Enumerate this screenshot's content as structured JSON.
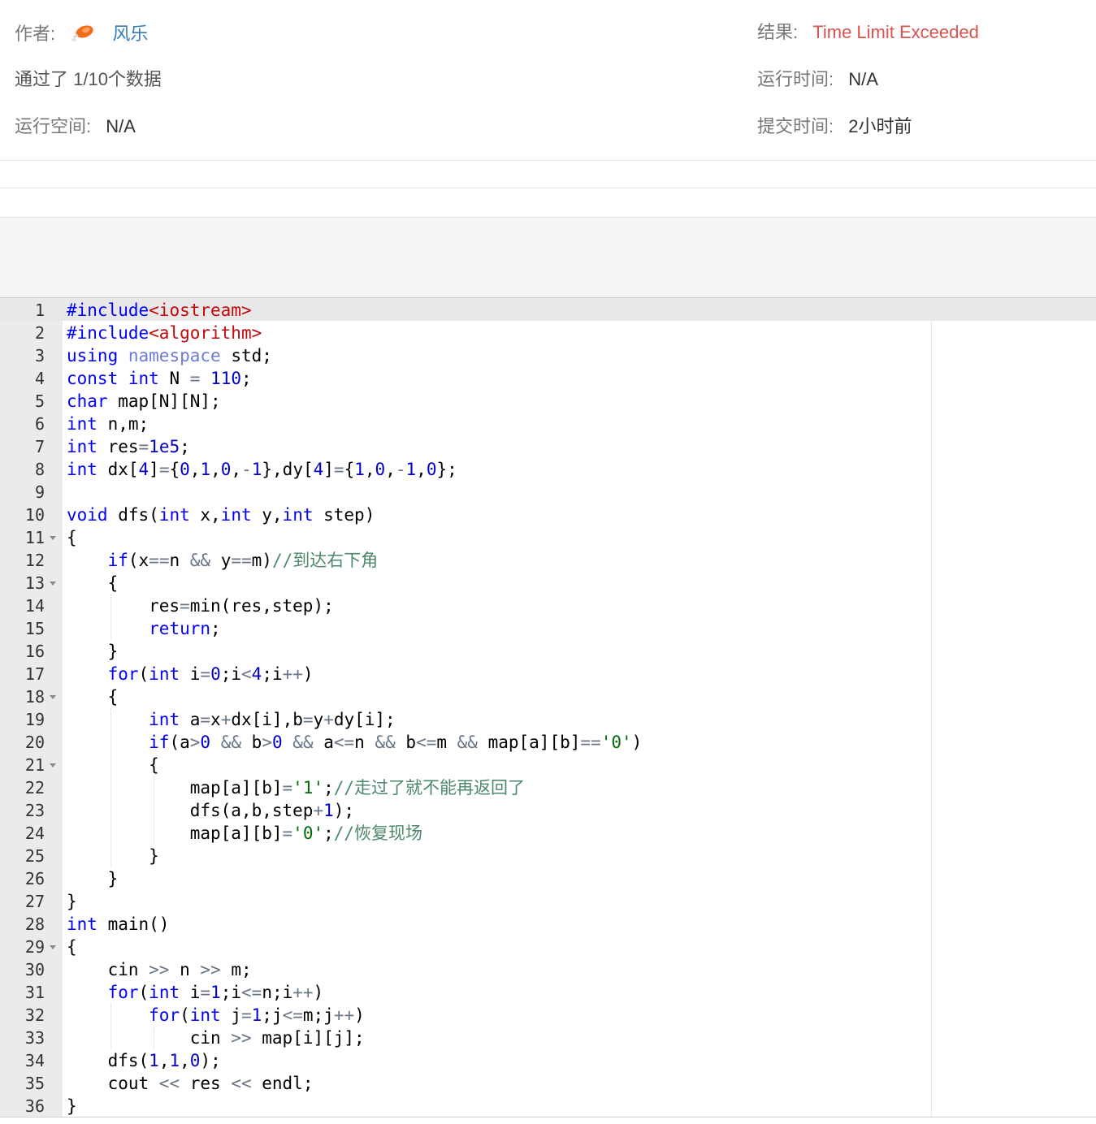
{
  "submission": {
    "author_label": "作者:",
    "author_name": "风乐",
    "result_label": "结果:",
    "result_value": "Time Limit Exceeded",
    "passed_text": "通过了 1/10个数据",
    "run_time_label": "运行时间:",
    "run_time_value": "N/A",
    "memory_label": "运行空间:",
    "memory_value": "N/A",
    "submit_time_label": "提交时间:",
    "submit_time_value": "2小时前"
  },
  "colors": {
    "result_red": "#d9534f",
    "author_link": "#337ab7",
    "keyword": "#0000ff",
    "string": "#c5060b",
    "number": "#0000cd",
    "comment": "#4c886b",
    "operator": "#687687",
    "char_literal": "#036a07"
  },
  "editor": {
    "active_line": 1,
    "fold_lines": [
      11,
      13,
      18,
      21,
      29
    ],
    "lines": [
      [
        [
          "kw",
          "#include"
        ],
        [
          "str",
          "<iostream>"
        ]
      ],
      [
        [
          "kw",
          "#include"
        ],
        [
          "str",
          "<algorithm>"
        ]
      ],
      [
        [
          "kw",
          "using"
        ],
        [
          "pl",
          " "
        ],
        [
          "ns",
          "namespace"
        ],
        [
          "pl",
          " std;"
        ]
      ],
      [
        [
          "kw",
          "const"
        ],
        [
          "pl",
          " "
        ],
        [
          "kw",
          "int"
        ],
        [
          "pl",
          " N "
        ],
        [
          "op",
          "="
        ],
        [
          "pl",
          " "
        ],
        [
          "num",
          "110"
        ],
        [
          "pl",
          ";"
        ]
      ],
      [
        [
          "kw",
          "char"
        ],
        [
          "pl",
          " map[N][N];"
        ]
      ],
      [
        [
          "kw",
          "int"
        ],
        [
          "pl",
          " n,m;"
        ]
      ],
      [
        [
          "kw",
          "int"
        ],
        [
          "pl",
          " res"
        ],
        [
          "op",
          "="
        ],
        [
          "num",
          "1e5"
        ],
        [
          "pl",
          ";"
        ]
      ],
      [
        [
          "kw",
          "int"
        ],
        [
          "pl",
          " dx["
        ],
        [
          "num",
          "4"
        ],
        [
          "pl",
          "]"
        ],
        [
          "op",
          "="
        ],
        [
          "pl",
          "{"
        ],
        [
          "num",
          "0"
        ],
        [
          "pl",
          ","
        ],
        [
          "num",
          "1"
        ],
        [
          "pl",
          ","
        ],
        [
          "num",
          "0"
        ],
        [
          "pl",
          ","
        ],
        [
          "op",
          "-"
        ],
        [
          "num",
          "1"
        ],
        [
          "pl",
          "},dy["
        ],
        [
          "num",
          "4"
        ],
        [
          "pl",
          "]"
        ],
        [
          "op",
          "="
        ],
        [
          "pl",
          "{"
        ],
        [
          "num",
          "1"
        ],
        [
          "pl",
          ","
        ],
        [
          "num",
          "0"
        ],
        [
          "pl",
          ","
        ],
        [
          "op",
          "-"
        ],
        [
          "num",
          "1"
        ],
        [
          "pl",
          ","
        ],
        [
          "num",
          "0"
        ],
        [
          "pl",
          "};"
        ]
      ],
      [
        [
          "pl",
          ""
        ]
      ],
      [
        [
          "kw",
          "void"
        ],
        [
          "pl",
          " dfs("
        ],
        [
          "kw",
          "int"
        ],
        [
          "pl",
          " x,"
        ],
        [
          "kw",
          "int"
        ],
        [
          "pl",
          " y,"
        ],
        [
          "kw",
          "int"
        ],
        [
          "pl",
          " step)"
        ]
      ],
      [
        [
          "pl",
          "{"
        ]
      ],
      [
        [
          "pl",
          "    "
        ],
        [
          "kw",
          "if"
        ],
        [
          "pl",
          "(x"
        ],
        [
          "op",
          "=="
        ],
        [
          "pl",
          "n "
        ],
        [
          "op",
          "&&"
        ],
        [
          "pl",
          " y"
        ],
        [
          "op",
          "=="
        ],
        [
          "pl",
          "m)"
        ],
        [
          "com",
          "//到达右下角"
        ]
      ],
      [
        [
          "pl",
          "    {"
        ]
      ],
      [
        [
          "pl",
          "        res"
        ],
        [
          "op",
          "="
        ],
        [
          "pl",
          "min(res,step);"
        ]
      ],
      [
        [
          "pl",
          "        "
        ],
        [
          "kw",
          "return"
        ],
        [
          "pl",
          ";"
        ]
      ],
      [
        [
          "pl",
          "    }"
        ]
      ],
      [
        [
          "pl",
          "    "
        ],
        [
          "kw",
          "for"
        ],
        [
          "pl",
          "("
        ],
        [
          "kw",
          "int"
        ],
        [
          "pl",
          " i"
        ],
        [
          "op",
          "="
        ],
        [
          "num",
          "0"
        ],
        [
          "pl",
          ";i"
        ],
        [
          "op",
          "<"
        ],
        [
          "num",
          "4"
        ],
        [
          "pl",
          ";i"
        ],
        [
          "op",
          "++"
        ],
        [
          "pl",
          ")"
        ]
      ],
      [
        [
          "pl",
          "    {"
        ]
      ],
      [
        [
          "pl",
          "        "
        ],
        [
          "kw",
          "int"
        ],
        [
          "pl",
          " a"
        ],
        [
          "op",
          "="
        ],
        [
          "pl",
          "x"
        ],
        [
          "op",
          "+"
        ],
        [
          "pl",
          "dx[i],b"
        ],
        [
          "op",
          "="
        ],
        [
          "pl",
          "y"
        ],
        [
          "op",
          "+"
        ],
        [
          "pl",
          "dy[i];"
        ]
      ],
      [
        [
          "pl",
          "        "
        ],
        [
          "kw",
          "if"
        ],
        [
          "pl",
          "(a"
        ],
        [
          "op",
          ">"
        ],
        [
          "num",
          "0"
        ],
        [
          "pl",
          " "
        ],
        [
          "op",
          "&&"
        ],
        [
          "pl",
          " b"
        ],
        [
          "op",
          ">"
        ],
        [
          "num",
          "0"
        ],
        [
          "pl",
          " "
        ],
        [
          "op",
          "&&"
        ],
        [
          "pl",
          " a"
        ],
        [
          "op",
          "<="
        ],
        [
          "pl",
          "n "
        ],
        [
          "op",
          "&&"
        ],
        [
          "pl",
          " b"
        ],
        [
          "op",
          "<="
        ],
        [
          "pl",
          "m "
        ],
        [
          "op",
          "&&"
        ],
        [
          "pl",
          " map[a][b]"
        ],
        [
          "op",
          "=="
        ],
        [
          "chr",
          "'0'"
        ],
        [
          "pl",
          ")"
        ]
      ],
      [
        [
          "pl",
          "        {"
        ]
      ],
      [
        [
          "pl",
          "            map[a][b]"
        ],
        [
          "op",
          "="
        ],
        [
          "chr",
          "'1'"
        ],
        [
          "pl",
          ";"
        ],
        [
          "com",
          "//走过了就不能再返回了"
        ]
      ],
      [
        [
          "pl",
          "            dfs(a,b,step"
        ],
        [
          "op",
          "+"
        ],
        [
          "num",
          "1"
        ],
        [
          "pl",
          ");"
        ]
      ],
      [
        [
          "pl",
          "            map[a][b]"
        ],
        [
          "op",
          "="
        ],
        [
          "chr",
          "'0'"
        ],
        [
          "pl",
          ";"
        ],
        [
          "com",
          "//恢复现场"
        ]
      ],
      [
        [
          "pl",
          "        }"
        ]
      ],
      [
        [
          "pl",
          "    }"
        ]
      ],
      [
        [
          "pl",
          "}"
        ]
      ],
      [
        [
          "kw",
          "int"
        ],
        [
          "pl",
          " main()"
        ]
      ],
      [
        [
          "pl",
          "{"
        ]
      ],
      [
        [
          "pl",
          "    cin "
        ],
        [
          "op",
          ">>"
        ],
        [
          "pl",
          " n "
        ],
        [
          "op",
          ">>"
        ],
        [
          "pl",
          " m;"
        ]
      ],
      [
        [
          "pl",
          "    "
        ],
        [
          "kw",
          "for"
        ],
        [
          "pl",
          "("
        ],
        [
          "kw",
          "int"
        ],
        [
          "pl",
          " i"
        ],
        [
          "op",
          "="
        ],
        [
          "num",
          "1"
        ],
        [
          "pl",
          ";i"
        ],
        [
          "op",
          "<="
        ],
        [
          "pl",
          "n;i"
        ],
        [
          "op",
          "++"
        ],
        [
          "pl",
          ")"
        ]
      ],
      [
        [
          "pl",
          "        "
        ],
        [
          "kw",
          "for"
        ],
        [
          "pl",
          "("
        ],
        [
          "kw",
          "int"
        ],
        [
          "pl",
          " j"
        ],
        [
          "op",
          "="
        ],
        [
          "num",
          "1"
        ],
        [
          "pl",
          ";j"
        ],
        [
          "op",
          "<="
        ],
        [
          "pl",
          "m;j"
        ],
        [
          "op",
          "++"
        ],
        [
          "pl",
          ")"
        ]
      ],
      [
        [
          "pl",
          "            cin "
        ],
        [
          "op",
          ">>"
        ],
        [
          "pl",
          " map[i][j];"
        ]
      ],
      [
        [
          "pl",
          "    dfs("
        ],
        [
          "num",
          "1"
        ],
        [
          "pl",
          ","
        ],
        [
          "num",
          "1"
        ],
        [
          "pl",
          ","
        ],
        [
          "num",
          "0"
        ],
        [
          "pl",
          ");"
        ]
      ],
      [
        [
          "pl",
          "    cout "
        ],
        [
          "op",
          "<<"
        ],
        [
          "pl",
          " res "
        ],
        [
          "op",
          "<<"
        ],
        [
          "pl",
          " endl;"
        ]
      ],
      [
        [
          "pl",
          "}"
        ]
      ]
    ]
  }
}
